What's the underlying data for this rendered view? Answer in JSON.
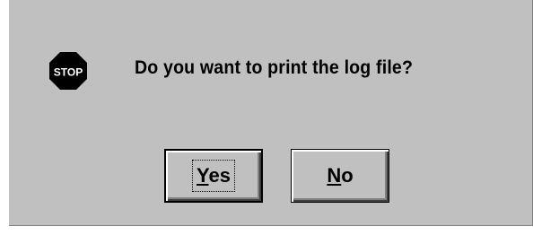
{
  "dialog": {
    "message": "Do you want to print the log file?",
    "icon": "stop-icon",
    "icon_text": "STOP",
    "colors": {
      "face": "#c0c0c0",
      "stop_sign": "#000000",
      "stop_text": "#ffffff"
    }
  },
  "buttons": {
    "yes": {
      "mnemonic": "Y",
      "rest": "es",
      "default": true
    },
    "no": {
      "mnemonic": "N",
      "rest": "o",
      "default": false
    }
  }
}
